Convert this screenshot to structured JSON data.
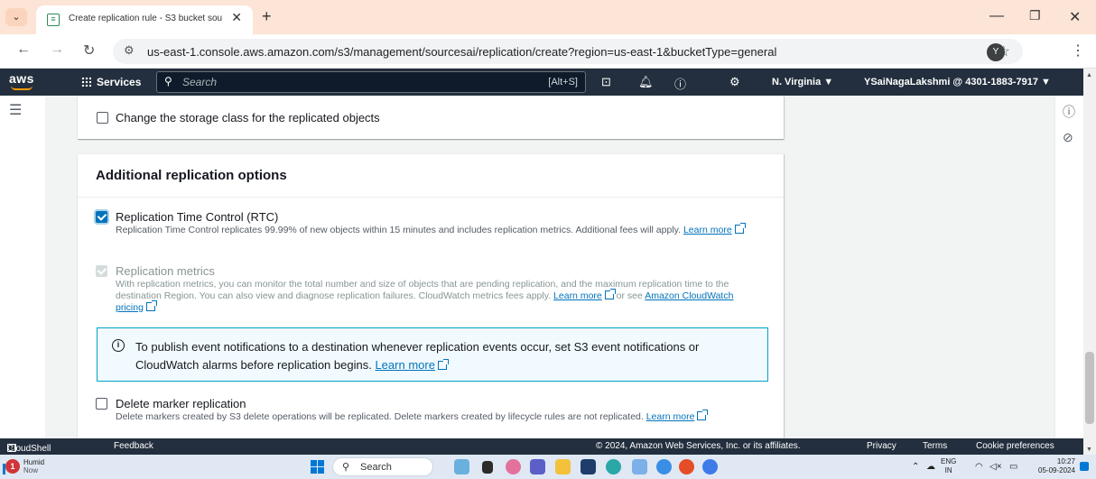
{
  "browser": {
    "tab_title": "Create replication rule - S3 bucket sou",
    "url": "us-east-1.console.aws.amazon.com/s3/management/sourcesai/replication/create?region=us-east-1&bucketType=general",
    "profile_initial": "Y"
  },
  "aws_header": {
    "logo": "aws",
    "services_label": "Services",
    "search_placeholder": "Search",
    "search_shortcut": "[Alt+S]",
    "region": "N. Virginia ▼",
    "account": "YSaiNagaLakshmi @ 4301-1883-7917 ▼"
  },
  "top_card": {
    "storage_class_label": "Change the storage class for the replicated objects"
  },
  "additional_options": {
    "title": "Additional replication options",
    "rtc": {
      "label": "Replication Time Control (RTC)",
      "desc": "Replication Time Control replicates 99.99% of new objects within 15 minutes and includes replication metrics. Additional fees will apply.",
      "link": "Learn more"
    },
    "metrics": {
      "label": "Replication metrics",
      "desc": "With replication metrics, you can monitor the total number and size of objects that are pending replication, and the maximum replication time to the destination Region. You can also view and diagnose replication failures. CloudWatch metrics fees apply.",
      "link": "Learn more",
      "or_see": "or see",
      "pricing_link": "Amazon CloudWatch pricing"
    },
    "info": {
      "text": "To publish event notifications to a destination whenever replication events occur, set S3 event notifications or CloudWatch alarms before replication begins.",
      "link": "Learn more"
    },
    "delete_marker": {
      "label": "Delete marker replication",
      "desc": "Delete markers created by S3 delete operations will be replicated. Delete markers created by lifecycle rules are not replicated.",
      "link": "Learn more"
    }
  },
  "aws_footer": {
    "cloudshell": "CloudShell",
    "feedback": "Feedback",
    "copyright": "© 2024, Amazon Web Services, Inc. or its affiliates.",
    "privacy": "Privacy",
    "terms": "Terms",
    "cookies": "Cookie preferences"
  },
  "taskbar": {
    "weather_badge": "1",
    "weather_label": "Humid",
    "weather_sub": "Now",
    "search_placeholder": "Search",
    "lang_line1": "ENG",
    "lang_line2": "IN",
    "time": "10:27",
    "date": "05-09-2024"
  },
  "colors": {
    "aws_nav": "#232f3e",
    "link": "#0073bb",
    "info_border": "#00a1c9",
    "info_bg": "#f1faff"
  }
}
